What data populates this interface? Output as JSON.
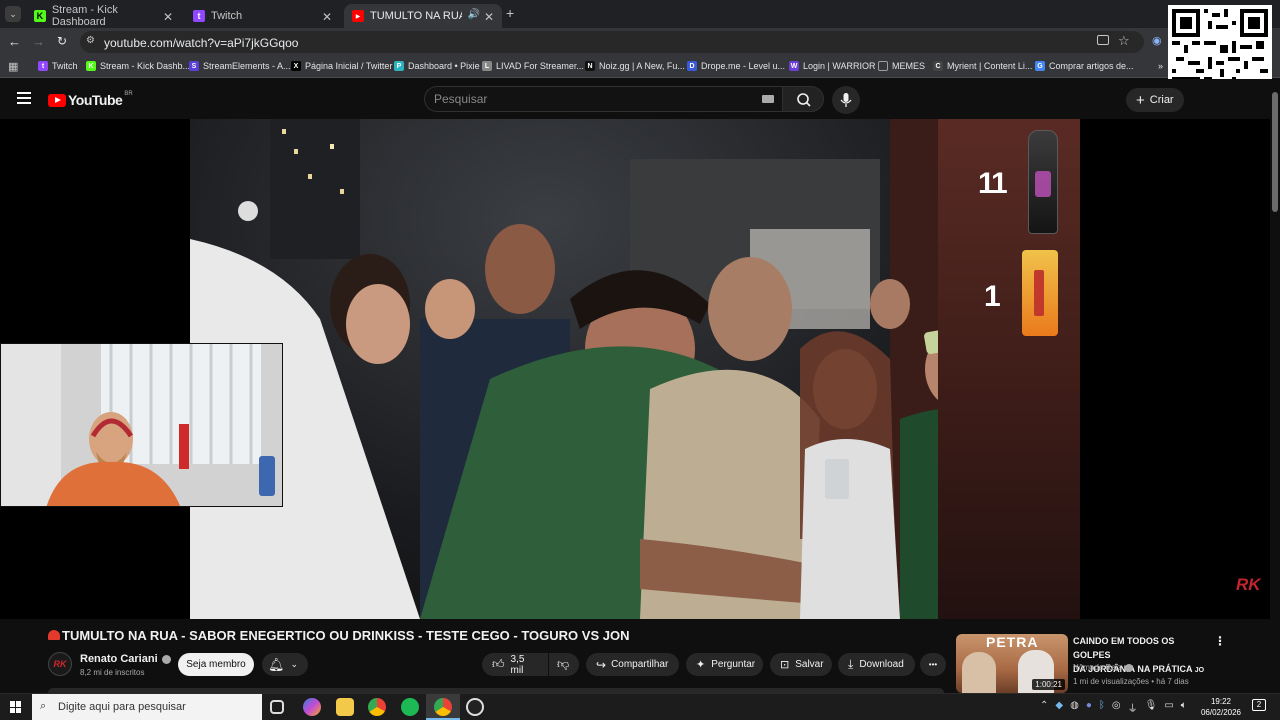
{
  "browser": {
    "tabs": [
      {
        "label": "Stream - Kick Dashboard",
        "favicon": "K",
        "color": "#53fc18"
      },
      {
        "label": "Twitch",
        "favicon": "t",
        "color": "#9146ff"
      },
      {
        "label": "TUMULTO NA RUA - SAB",
        "favicon": "▶",
        "color": "#ff0000"
      }
    ],
    "new_tab": "+",
    "url": "youtube.com/watch?v=aPi7jkGGqoo",
    "bookmarks": [
      {
        "label": "Twitch",
        "color": "#9146ff",
        "icon": "t"
      },
      {
        "label": "Stream - Kick Dashb...",
        "color": "#53fc18",
        "icon": "K"
      },
      {
        "label": "StreamElements - A...",
        "color": "#5a3fd8",
        "icon": "S"
      },
      {
        "label": "Página Inicial / Twitter",
        "color": "#000000",
        "icon": "X"
      },
      {
        "label": "Dashboard • Pixie",
        "color": "#2bb3c0",
        "icon": "P"
      },
      {
        "label": "LIVAD For Streamer...",
        "color": "#888888",
        "icon": "L"
      },
      {
        "label": "Noiz.gg | A New, Fu...",
        "color": "#111111",
        "icon": "N"
      },
      {
        "label": "Drope.me - Level u...",
        "color": "#3a5bd9",
        "icon": "D"
      },
      {
        "label": "Login | WARRIOR",
        "color": "#6b3fd8",
        "icon": "W"
      },
      {
        "label": "MEMES",
        "color": "#9aa0a6",
        "icon": "folder"
      },
      {
        "label": "Myrient | Content Li...",
        "color": "#444444",
        "icon": "C"
      },
      {
        "label": "Comprar artigos de...",
        "color": "#4285f4",
        "icon": "G"
      }
    ]
  },
  "youtube": {
    "logo": "YouTube",
    "region": "BR",
    "search_placeholder": "Pesquisar",
    "create_label": "Criar"
  },
  "video": {
    "overlay_count_top": "11",
    "overlay_count_bottom": "1",
    "watermark": "RK"
  },
  "meta": {
    "title": "TUMULTO NA RUA - SABOR ENEGERTICO OU DRINKISS - TESTE CEGO - TOGURO VS JON",
    "channel": "Renato Cariani",
    "subscribers": "8,2 mi de inscritos",
    "subscribe_label": "Seja membro",
    "likes": "3,5 mil",
    "share": "Compartilhar",
    "ask": "Perguntar",
    "save": "Salvar",
    "download": "Download",
    "more": "•••"
  },
  "recommended": {
    "title_line1": "CAINDO EM TODOS OS GOLPES",
    "title_line2": "DA JORDÂNIA NA PRÁTICA",
    "title_suffix": "JO",
    "channel": "Nômade Raiz",
    "stats": "1 mi de visualizações • há 7 dias",
    "duration": "1:00:21",
    "thumb_text": "PETRA"
  },
  "taskbar": {
    "search_placeholder": "Digite aqui para pesquisar",
    "time": "19:22",
    "date": "06/02/2026",
    "notification_count": "2"
  }
}
